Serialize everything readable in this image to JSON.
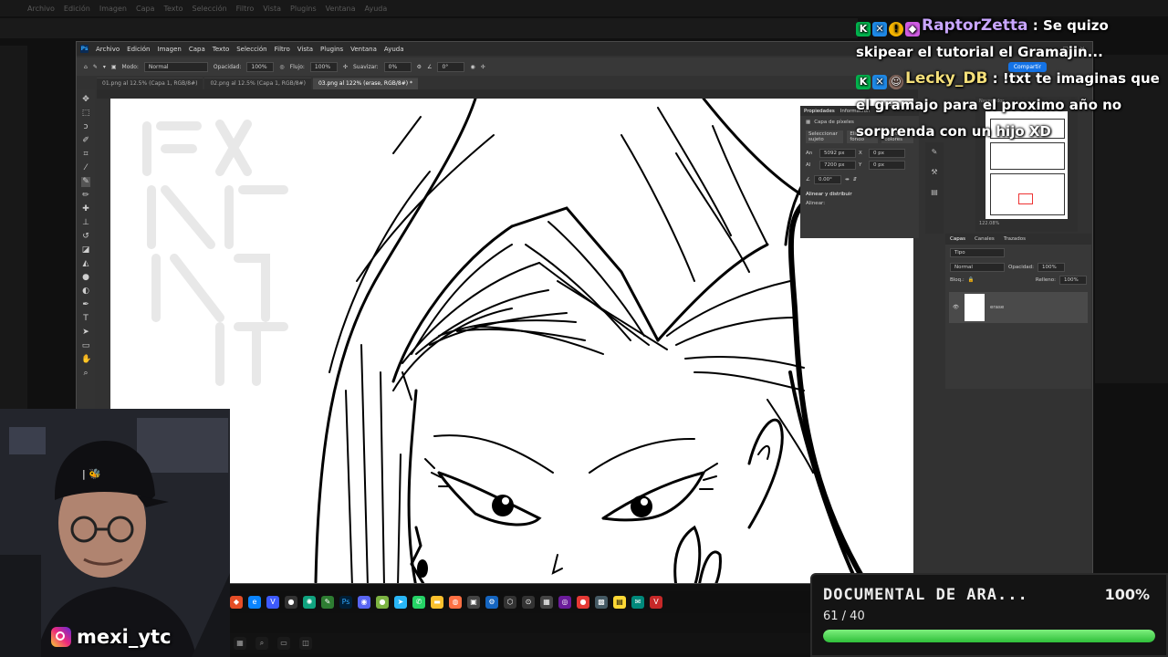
{
  "background": {
    "menu": [
      "Archivo",
      "Edición",
      "Imagen",
      "Capa",
      "Texto",
      "Selección",
      "Filtro",
      "Vista",
      "Plugins",
      "Ventana",
      "Ayuda"
    ]
  },
  "photoshop": {
    "logo": "Ps",
    "menu": [
      "Archivo",
      "Edición",
      "Imagen",
      "Capa",
      "Texto",
      "Selección",
      "Filtro",
      "Vista",
      "Plugins",
      "Ventana",
      "Ayuda"
    ],
    "options": {
      "mode_label": "Modo:",
      "mode_value": "Normal",
      "opacity_label": "Opacidad:",
      "opacity_value": "100%",
      "flow_label": "Flujo:",
      "flow_value": "100%",
      "smooth_label": "Suavizar:",
      "smooth_value": "0%",
      "angle_value": "0°"
    },
    "tabs": [
      {
        "label": "01.png al 12.5% (Capa 1, RGB/8#)",
        "active": false
      },
      {
        "label": "02.png al 12.5% (Capa 1, RGB/8#)",
        "active": false
      },
      {
        "label": "03.png al 122% (erase, RGB/8#) *",
        "active": true
      }
    ],
    "share_button": "Compartir",
    "properties_panel": {
      "tabs": [
        "Propiedades",
        "Información"
      ],
      "section_pixel_layer": "Capa de píxeles",
      "select_subject": "Seleccionar sujeto",
      "remove_bg": "Eliminar fondo",
      "adjust_colors": "Ajustar colores",
      "width_label": "An",
      "width_value": "5092 px",
      "height_label": "Al",
      "height_value": "7200 px",
      "x_label": "X",
      "x_value": "0 px",
      "y_label": "Y",
      "y_value": "0 px",
      "angle_value": "0.00°",
      "align_section": "Alinear y distribuir",
      "align_label": "Alinear:"
    },
    "navigator": {
      "label": "Navegador",
      "zoom": "122.08%"
    },
    "layers_panel": {
      "tabs": [
        "Capas",
        "Canales",
        "Trazados"
      ],
      "filter_label": "Tipo",
      "blend_mode": "Normal",
      "opacity_label": "Opacidad:",
      "opacity_value": "100%",
      "lock_label": "Bloq.:",
      "fill_label": "Relleno:",
      "fill_value": "100%",
      "layers": [
        {
          "name": "erase",
          "visible": true
        }
      ]
    }
  },
  "chat": {
    "messages": [
      {
        "user": "RaptorZetta",
        "user_color": "#c9a6ff",
        "text": ": Se quizo skipear el tutorial el Gramajin..."
      },
      {
        "user": "Lecky_DB",
        "user_color": "#f4df7a",
        "text": ": !txt te imaginas que el gramajo para el proximo año no sorprenda con un hijo XD"
      }
    ]
  },
  "webcam": {
    "instagram_handle": "mexi_ytc",
    "cap_logo": "| 🐝"
  },
  "goal": {
    "title": "DOCUMENTAL DE ARA...",
    "percent_label": "100%",
    "count": "61 / 40",
    "progress": 1.0
  },
  "colors": {
    "accent_ps": "#31a8ff",
    "goal_bar": "#3ed94a",
    "share_button": "#1473e6"
  }
}
